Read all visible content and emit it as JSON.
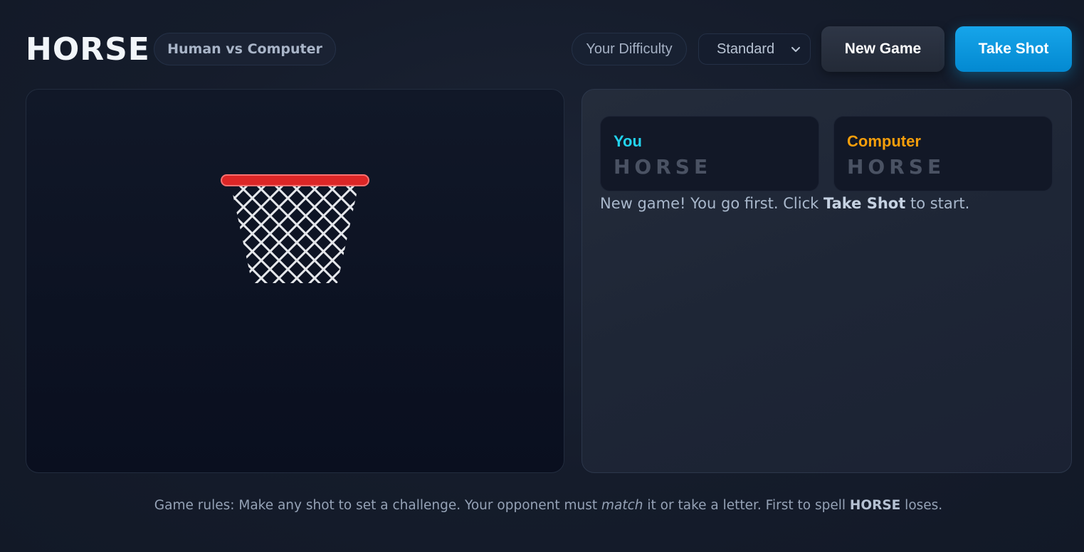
{
  "header": {
    "title": "HORSE",
    "mode": "Human vs Computer",
    "difficulty_label": "Your Difficulty",
    "difficulty_value": "Standard",
    "new_game_label": "New Game",
    "take_shot_label": "Take Shot"
  },
  "scoreboard": {
    "you": {
      "name": "You",
      "letters": "HORSE",
      "color": "#22d3ee"
    },
    "computer": {
      "name": "Computer",
      "letters": "HORSE",
      "color": "#f59e0b"
    }
  },
  "status": {
    "prefix": "New game! You go first. Click ",
    "emphasis": "Take Shot",
    "suffix": " to start."
  },
  "rules": {
    "part1": "Game rules: Make any shot to set a challenge. Your opponent must ",
    "match": "match",
    "part2": " it or take a letter. First to spell ",
    "horse": "HORSE",
    "part3": " loses."
  },
  "colors": {
    "accent": "#0ea5e9",
    "rim": "#e53e3e",
    "net": "#e5e7eb"
  },
  "icons": {
    "select_arrow": "chevron-down-icon"
  }
}
